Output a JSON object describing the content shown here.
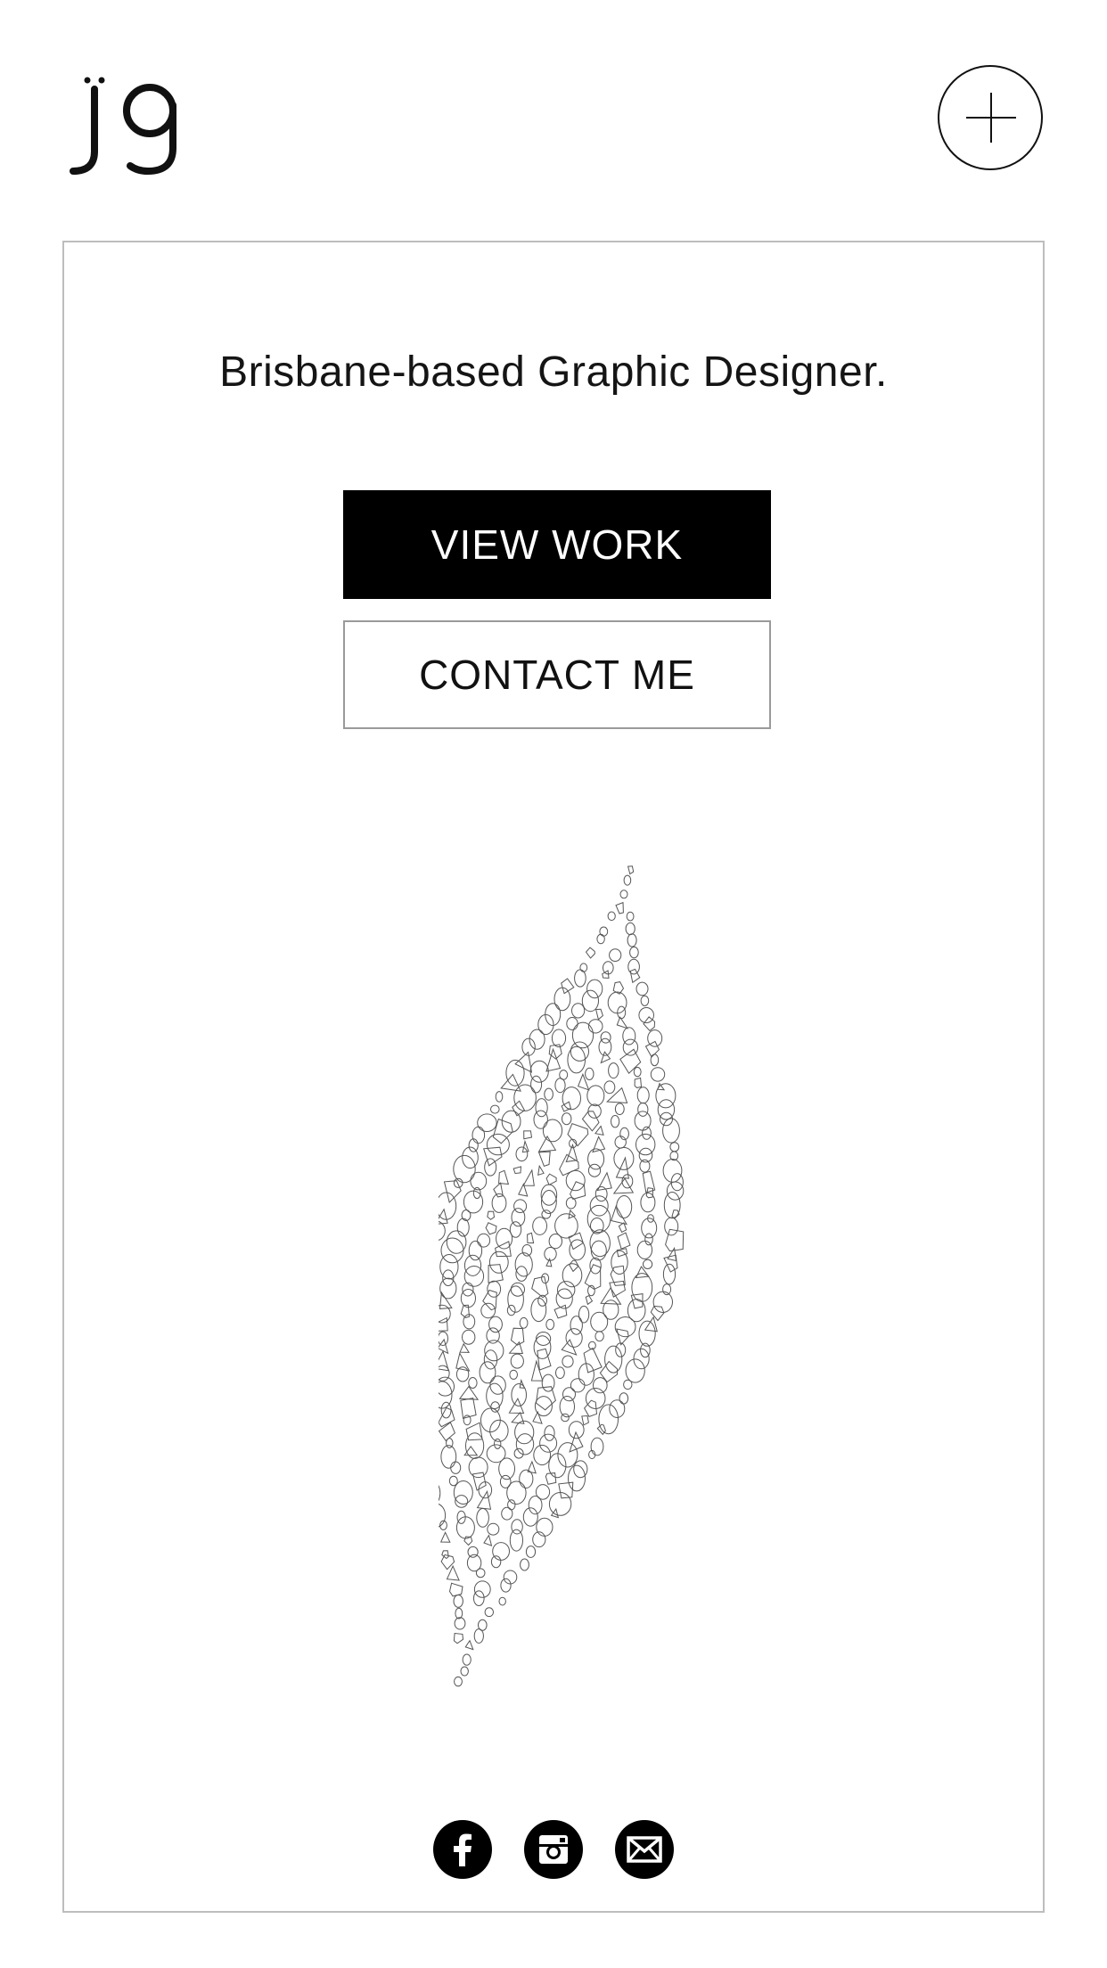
{
  "header": {
    "logo_text": "jg",
    "menu_icon": "plus-icon"
  },
  "hero": {
    "tagline": "Brisbane-based Graphic Designer.",
    "view_work_label": "VIEW WORK",
    "contact_label": "CONTACT ME",
    "illustration": "leaf-mosaic-illustration"
  },
  "social": [
    {
      "name": "facebook-icon"
    },
    {
      "name": "instagram-icon"
    },
    {
      "name": "email-icon"
    }
  ],
  "colors": {
    "primary": "#000000",
    "background": "#ffffff",
    "border": "#bdbdbd"
  }
}
